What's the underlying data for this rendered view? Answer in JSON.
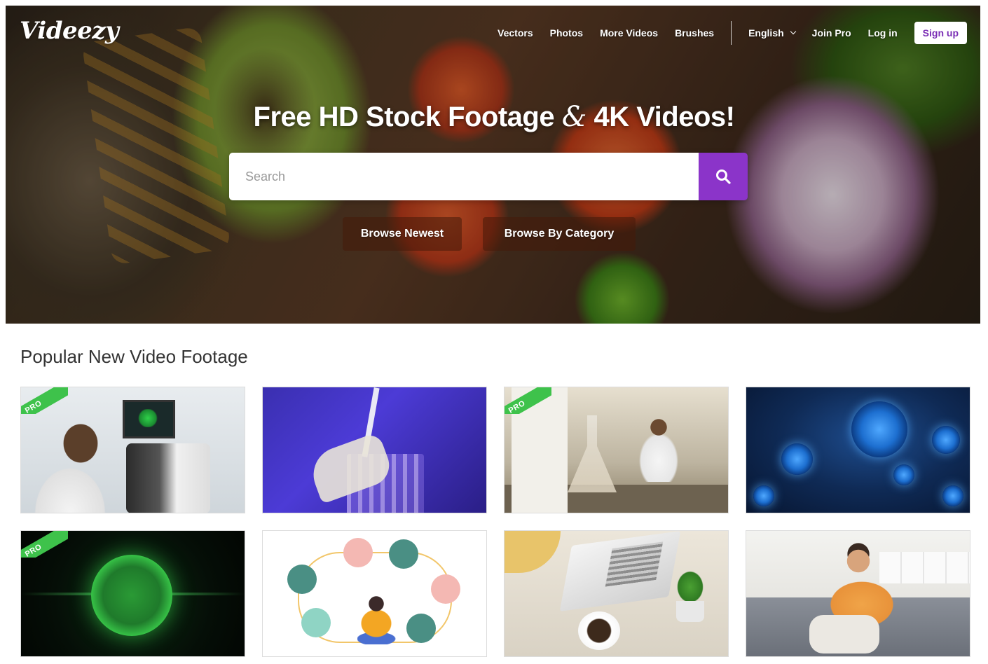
{
  "brand": {
    "logo": "Videezy",
    "accent_color": "#8b34c9",
    "pro_badge_color": "#3ec24b"
  },
  "nav": {
    "links": [
      "Vectors",
      "Photos",
      "More Videos",
      "Brushes"
    ],
    "language": "English",
    "join_pro": "Join Pro",
    "login": "Log in",
    "signup": "Sign up"
  },
  "hero": {
    "title_part1": "Free HD Stock Footage ",
    "title_amp": "&",
    "title_part2": " 4K Videos!",
    "search_placeholder": "Search",
    "search_icon": "search-icon",
    "browse_newest": "Browse Newest",
    "browse_category": "Browse By Category"
  },
  "section": {
    "title": "Popular New Video Footage",
    "pro_label": "PRO",
    "tiles": [
      {
        "subject": "scientist-microscope",
        "pro": true
      },
      {
        "subject": "lab-pipette",
        "pro": false
      },
      {
        "subject": "laboratory-workers",
        "pro": true
      },
      {
        "subject": "blue-virus",
        "pro": false
      },
      {
        "subject": "green-cell-orb",
        "pro": true
      },
      {
        "subject": "online-shopping-illustration",
        "pro": false
      },
      {
        "subject": "laptop-coffee-desk",
        "pro": false
      },
      {
        "subject": "man-on-sofa-phone",
        "pro": false
      }
    ]
  }
}
